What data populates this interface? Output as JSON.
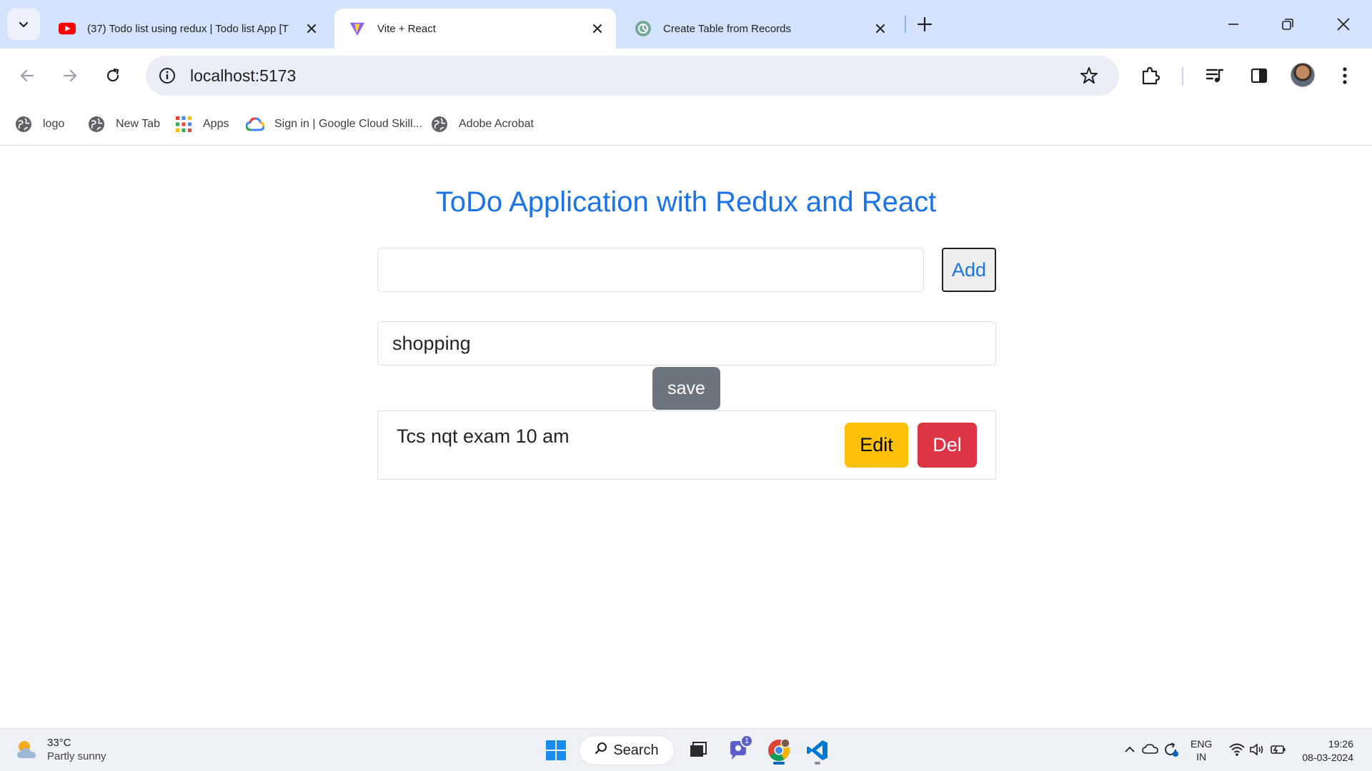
{
  "browser": {
    "tabs": [
      {
        "label": "(37) Todo list using redux | Todo list App [T",
        "favicon": "youtube-icon",
        "active": false
      },
      {
        "label": "Vite + React",
        "favicon": "vite-icon",
        "active": true
      },
      {
        "label": "Create Table from Records",
        "favicon": "chatgpt-icon",
        "active": false
      }
    ],
    "address": "localhost:5173",
    "bookmarks": [
      {
        "label": "logo",
        "icon": "globe-icon"
      },
      {
        "label": "New Tab",
        "icon": "globe-icon"
      },
      {
        "label": "Apps",
        "icon": "apps-grid-icon"
      },
      {
        "label": "Sign in | Google Cloud Skill...",
        "icon": "google-cloud-icon"
      },
      {
        "label": "Adobe Acrobat",
        "icon": "globe-icon"
      }
    ]
  },
  "app": {
    "title": "ToDo Application with Redux and React",
    "new_todo": {
      "value": ""
    },
    "add_label": "Add",
    "edit_field_value": "shopping",
    "save_label": "save",
    "todos": [
      {
        "text": "Tcs nqt exam 10 am",
        "edit_label": "Edit",
        "delete_label": "Del"
      }
    ]
  },
  "colors": {
    "title": "#1a73e8",
    "edit_button": "#ffc107",
    "delete_button": "#dc3545",
    "save_button": "#6c757d"
  },
  "taskbar": {
    "weather": {
      "temp": "33°C",
      "condition": "Partly sunny"
    },
    "search_label": "Search",
    "chat_badge": "1",
    "language": {
      "line1": "ENG",
      "line2": "IN"
    },
    "clock": {
      "time": "19:26",
      "date": "08-03-2024"
    }
  }
}
